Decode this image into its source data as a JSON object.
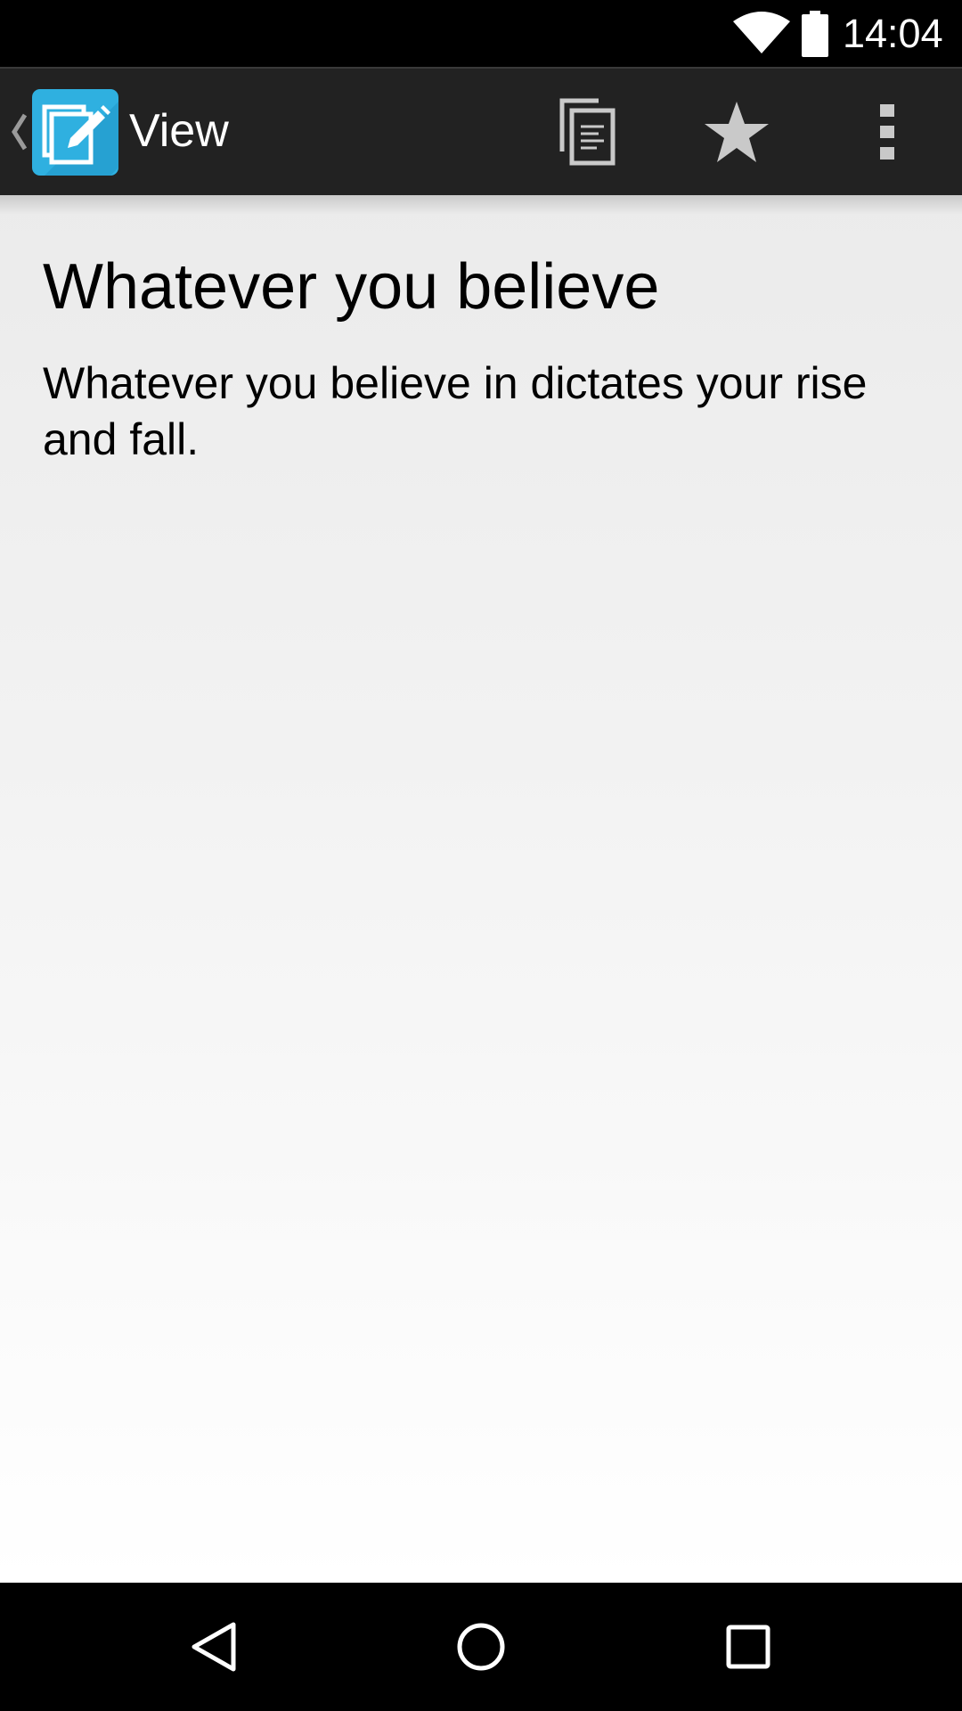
{
  "status_bar": {
    "time": "14:04",
    "icons": [
      "wifi-icon",
      "battery-icon"
    ]
  },
  "action_bar": {
    "up_icon": "chevron-left-icon",
    "app_icon": "edit-note-icon",
    "title": "View",
    "actions": [
      {
        "name": "copy",
        "icon": "copy-document-icon"
      },
      {
        "name": "favorite",
        "icon": "star-icon"
      },
      {
        "name": "more",
        "icon": "overflow-menu-icon"
      }
    ]
  },
  "note": {
    "title": "Whatever you believe",
    "body": "Whatever you believe in dictates your rise and fall."
  },
  "nav_bar": {
    "buttons": [
      "back-icon",
      "home-icon",
      "recents-icon"
    ]
  },
  "colors": {
    "action_bar_bg": "#222222",
    "app_icon_blue": "#2fb0e0",
    "action_icon_gray": "#c9c9c9",
    "content_bg_top": "#ebebeb",
    "content_bg_bottom": "#ffffff"
  }
}
